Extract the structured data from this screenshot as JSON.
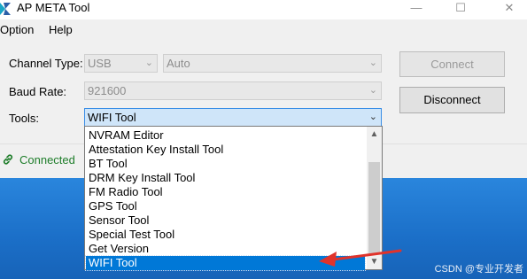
{
  "window": {
    "title": "AP META Tool",
    "minimize_glyph": "—",
    "maximize_glyph": "☐",
    "close_glyph": "✕"
  },
  "menu": [
    "Option",
    "Help"
  ],
  "form": {
    "channel_type_label": "Channel Type:",
    "channel_type_value": "USB",
    "channel_mode_value": "Auto",
    "baud_rate_label": "Baud Rate:",
    "baud_rate_value": "921600",
    "tools_label": "Tools:",
    "tools_value": "WIFI Tool"
  },
  "buttons": {
    "connect": "Connect",
    "disconnect": "Disconnect"
  },
  "status": {
    "text": "Connected",
    "color": "#1e7d2a"
  },
  "dropdown": {
    "options": [
      "NVRAM Editor",
      "Attestation Key Install Tool",
      "BT Tool",
      "DRM Key Install Tool",
      "FM Radio Tool",
      "GPS Tool",
      "Sensor Tool",
      "Special Test Tool",
      "Get Version",
      "WIFI Tool"
    ],
    "selected": "WIFI Tool"
  },
  "annotation": {
    "arrow_color": "#e0332b"
  },
  "watermark": "CSDN @专业开发者"
}
